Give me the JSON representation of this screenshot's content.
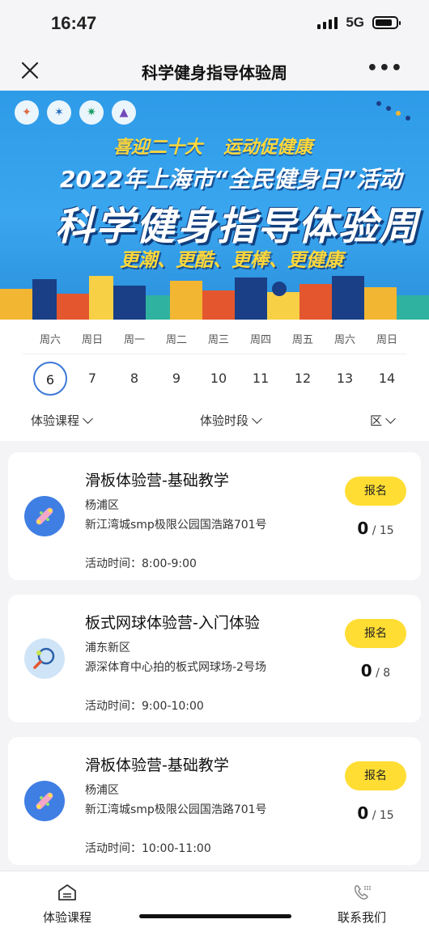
{
  "status_bar": {
    "time": "16:47",
    "network": "5G"
  },
  "nav": {
    "title": "科学健身指导体验周",
    "more": "•••"
  },
  "banner": {
    "slogan_left": "喜迎二十大",
    "slogan_right": "运动促健康",
    "event_line": "2022年上海市“全民健身日”活动",
    "headline": "科学健身指导体验周",
    "subline": "更潮、更酷、更棒、更健康"
  },
  "calendar": {
    "weekdays": [
      "周六",
      "周日",
      "周一",
      "周二",
      "周三",
      "周四",
      "周五",
      "周六",
      "周日"
    ],
    "dates": [
      "6",
      "7",
      "8",
      "9",
      "10",
      "11",
      "12",
      "13",
      "14"
    ],
    "selected_index": 0
  },
  "filters": {
    "course": "体验课程",
    "period": "体验时段",
    "district": "区"
  },
  "courses": [
    {
      "name": "滑板体验营-基础教学",
      "district": "杨浦区",
      "address": "新江湾城smp极限公园国浩路701号",
      "time": "活动时间：8:00-9:00",
      "button": "报名",
      "enrolled": "0",
      "capacity": "/ 15",
      "icon": "skateboard-icon"
    },
    {
      "name": "板式网球体验营-入门体验",
      "district": "浦东新区",
      "address": "源深体育中心拍的板式网球场-2号场",
      "time": "活动时间：9:00-10:00",
      "button": "报名",
      "enrolled": "0",
      "capacity": "/ 8",
      "icon": "tennis-icon"
    },
    {
      "name": "滑板体验营-基础教学",
      "district": "杨浦区",
      "address": "新江湾城smp极限公园国浩路701号",
      "time": "活动时间：10:00-11:00",
      "button": "报名",
      "enrolled": "0",
      "capacity": "/ 15",
      "icon": "skateboard-icon"
    }
  ],
  "tabbar": {
    "courses": "体验课程",
    "contact": "联系我们"
  },
  "colors": {
    "accent_yellow": "#ffdd33",
    "selected_ring": "#3c78d8",
    "banner_blue": "#3aa6ef"
  }
}
